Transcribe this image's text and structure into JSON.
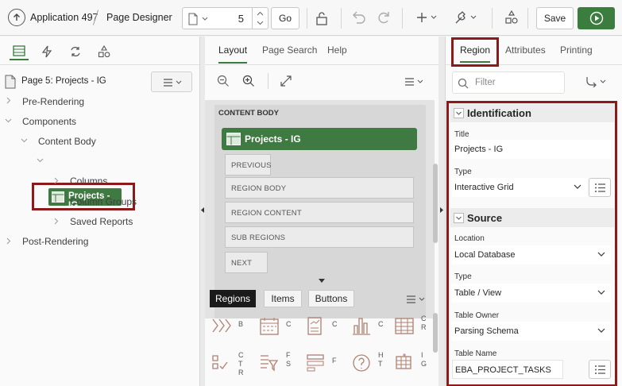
{
  "toolbar": {
    "app_label": "Application 497",
    "designer_label": "Page Designer",
    "page_number": "5",
    "go_label": "Go",
    "save_label": "Save"
  },
  "left": {
    "page_title": "Page 5: Projects - IG",
    "tree": {
      "pre_rendering": "Pre-Rendering",
      "components": "Components",
      "content_body": "Content Body",
      "projects_ig": "Projects - IG",
      "columns": "Columns",
      "column_groups": "Column Groups",
      "saved_reports": "Saved Reports",
      "post_rendering": "Post-Rendering"
    }
  },
  "center": {
    "tabs": [
      "Layout",
      "Page Search",
      "Help"
    ],
    "content_body_label": "CONTENT BODY",
    "region_title": "Projects - IG",
    "slots": [
      "PREVIOUS",
      "REGION BODY",
      "REGION CONTENT",
      "SUB REGIONS",
      "NEXT"
    ],
    "gallery_tabs": [
      "Regions",
      "Items",
      "Buttons"
    ],
    "gallery_items": [
      {
        "label": "B",
        "icon": "breadcrumb-icon"
      },
      {
        "label": "C",
        "icon": "calendar-icon"
      },
      {
        "label": "C",
        "icon": "chart-report-icon"
      },
      {
        "label": "C",
        "icon": "bar-chart-icon"
      },
      {
        "label": "C\nR",
        "icon": "classic-report-icon"
      },
      {
        "label": "C\nT\nR",
        "icon": "check-list-icon"
      },
      {
        "label": "F\nS",
        "icon": "faceted-search-icon"
      },
      {
        "label": "F",
        "icon": "form-icon"
      },
      {
        "label": "H\nT",
        "icon": "help-text-icon"
      },
      {
        "label": "I\nG",
        "icon": "interactive-grid-icon"
      }
    ]
  },
  "right": {
    "tabs": [
      "Region",
      "Attributes",
      "Printing"
    ],
    "filter_placeholder": "Filter",
    "identification": {
      "heading": "Identification",
      "title_label": "Title",
      "title_value": "Projects - IG",
      "type_label": "Type",
      "type_value": "Interactive Grid"
    },
    "source": {
      "heading": "Source",
      "location_label": "Location",
      "location_value": "Local Database",
      "type_label": "Type",
      "type_value": "Table / View",
      "owner_label": "Table Owner",
      "owner_value": "Parsing Schema",
      "name_label": "Table Name",
      "name_value": "EBA_PROJECT_TASKS"
    }
  },
  "colors": {
    "accent_green": "#3f7a42",
    "highlight_red": "#8d1a1a",
    "run_green": "#3b7d3f"
  }
}
